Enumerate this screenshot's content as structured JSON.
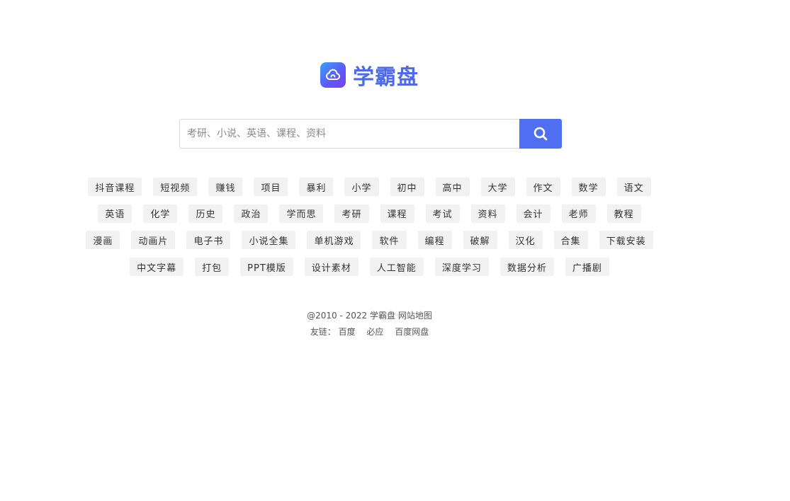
{
  "logo": {
    "text": "学霸盘",
    "icon": "cloud-icon",
    "gradient": [
      "#3aa0ff",
      "#7b3ff2"
    ],
    "text_color": "#4d6be8"
  },
  "search": {
    "placeholder": "考研、小说、英语、课程、资料",
    "value": "",
    "button_icon": "search-icon",
    "button_color": "#4f6ef2"
  },
  "tags": {
    "row1": [
      "抖音课程",
      "短视频",
      "赚钱",
      "项目",
      "暴利",
      "小学",
      "初中",
      "高中",
      "大学",
      "作文",
      "数学",
      "语文"
    ],
    "row2": [
      "英语",
      "化学",
      "历史",
      "政治",
      "学而思",
      "考研",
      "课程",
      "考试",
      "资料",
      "会计",
      "老师",
      "教程"
    ],
    "row3": [
      "漫画",
      "动画片",
      "电子书",
      "小说全集",
      "单机游戏",
      "软件",
      "编程",
      "破解",
      "汉化",
      "合集",
      "下载安装"
    ],
    "row4": [
      "中文字幕",
      "打包",
      "PPT模版",
      "设计素材",
      "人工智能",
      "深度学习",
      "数据分析",
      "广播剧"
    ]
  },
  "footer": {
    "copyright": "@2010 - 2022",
    "site_name": "学霸盘",
    "sitemap": "网站地图",
    "links_label": "友链：",
    "links": [
      "百度",
      "必应",
      "百度网盘"
    ]
  }
}
